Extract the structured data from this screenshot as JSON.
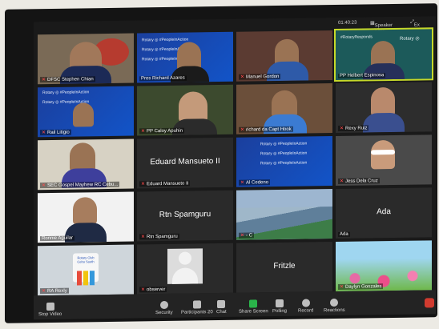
{
  "top_bar": {
    "time": "01:40:23",
    "view_label": "Speaker View",
    "exit_label": "Ex"
  },
  "participants": [
    {
      "name": "DFSC Stephen Chian"
    },
    {
      "name": "Pres Richard Azares"
    },
    {
      "name": "Manuel Gordon"
    },
    {
      "name": "PP Helbert Espinosa"
    },
    {
      "name": "Rail Litigio"
    },
    {
      "name": "PP Caloy Apuhin"
    },
    {
      "name": "richard da Capt Hook"
    },
    {
      "name": "Rexy Ruiz"
    },
    {
      "name": "SEC Gospel Mayhew RC Cebu..."
    },
    {
      "name": "Eduard Mansueto II"
    },
    {
      "name": "Al Cedeno"
    },
    {
      "name": "Jess Dela Cruz"
    },
    {
      "name": "Ronnie Aguilar"
    },
    {
      "name": "Rtn Spamguru"
    },
    {
      "name": "- C"
    },
    {
      "name": "Ada"
    },
    {
      "name": "RA Rexly"
    },
    {
      "name": "observer"
    },
    {
      "name": "Fritzle"
    },
    {
      "name": "Daylyn Gonzales"
    }
  ],
  "big_names": {
    "eduard": "Eduard Mansueto II",
    "rtn": "Rtn Spamguru",
    "ada": "Ada",
    "fritzle": "Fritzle"
  },
  "logo_text": {
    "line1": "Rotary Club",
    "line2": "Cebu South"
  },
  "toolbar": {
    "stop_video": "Stop Video",
    "security": "Security",
    "participants": "Participants",
    "participant_count": "20",
    "chat": "Chat",
    "share_screen": "Share Screen",
    "polling": "Polling",
    "record": "Record",
    "reactions": "Reactions"
  },
  "colors": {
    "active_border": "#c6d92a",
    "toolbar_bg": "#232323",
    "share_green": "#2ab44a",
    "rotary_blue": "#1a49b2",
    "end_red": "#d13b2f"
  }
}
